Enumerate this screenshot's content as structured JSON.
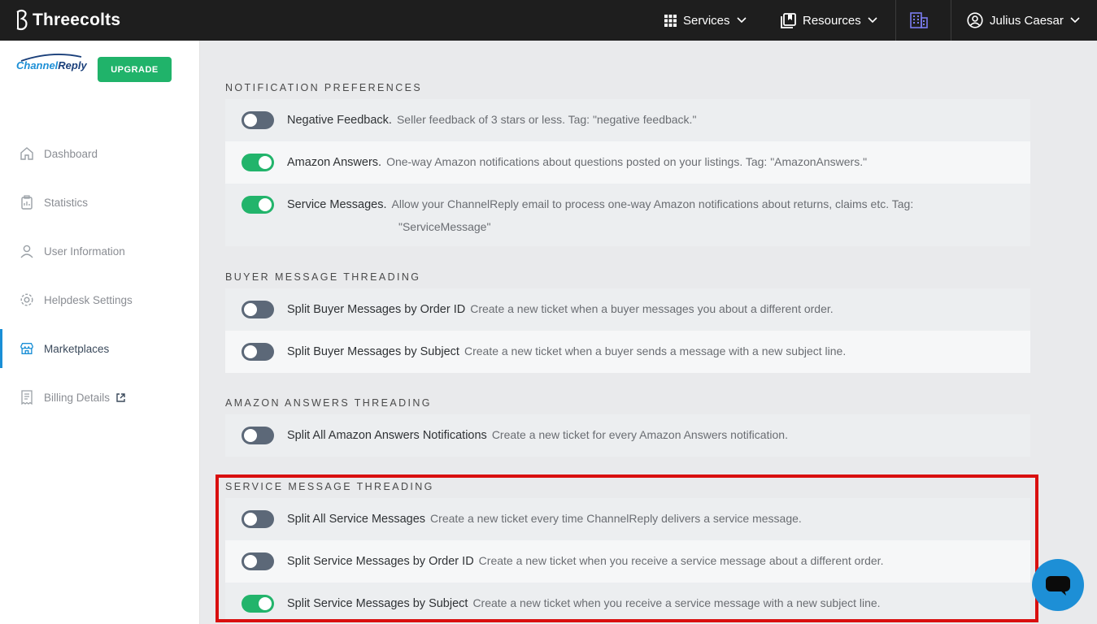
{
  "topbar": {
    "brand": "Threecolts",
    "services_label": "Services",
    "resources_label": "Resources",
    "user_name": "Julius Caesar"
  },
  "sidebar": {
    "logo_part1": "Channel",
    "logo_part2": "Reply",
    "upgrade_label": "UPGRADE",
    "items": [
      {
        "label": "Dashboard",
        "icon": "home-icon"
      },
      {
        "label": "Statistics",
        "icon": "clipboard-icon"
      },
      {
        "label": "User Information",
        "icon": "user-icon"
      },
      {
        "label": "Helpdesk Settings",
        "icon": "gear-icon"
      },
      {
        "label": "Marketplaces",
        "icon": "store-icon",
        "active": true
      },
      {
        "label": "Billing Details",
        "icon": "receipt-icon"
      }
    ]
  },
  "sections": [
    {
      "title": "NOTIFICATION PREFERENCES",
      "rows": [
        {
          "label": "Negative Feedback.",
          "desc": "Seller feedback of 3 stars or less. Tag: \"negative feedback.\"",
          "enabled": false
        },
        {
          "label": "Amazon Answers.",
          "desc": "One-way Amazon notifications about questions posted on your listings. Tag: \"AmazonAnswers.\"",
          "enabled": true
        },
        {
          "label": "Service Messages.",
          "desc": "Allow your ChannelReply email to process one-way Amazon notifications about returns, claims etc. Tag:",
          "desc2": "\"ServiceMessage\"",
          "enabled": true
        }
      ]
    },
    {
      "title": "BUYER MESSAGE THREADING",
      "rows": [
        {
          "label": "Split Buyer Messages by Order ID",
          "desc": "Create a new ticket when a buyer messages you about a different order.",
          "enabled": false
        },
        {
          "label": "Split Buyer Messages by Subject",
          "desc": "Create a new ticket when a buyer sends a message with a new subject line.",
          "enabled": false
        }
      ]
    },
    {
      "title": "AMAZON ANSWERS THREADING",
      "rows": [
        {
          "label": "Split All Amazon Answers Notifications",
          "desc": "Create a new ticket for every Amazon Answers notification.",
          "enabled": false
        }
      ]
    },
    {
      "title": "SERVICE MESSAGE THREADING",
      "rows": [
        {
          "label": "Split All Service Messages",
          "desc": "Create a new ticket every time ChannelReply delivers a service message.",
          "enabled": false
        },
        {
          "label": "Split Service Messages by Order ID",
          "desc": "Create a new ticket when you receive a service message about a different order.",
          "enabled": false
        },
        {
          "label": "Split Service Messages by Subject",
          "desc": "Create a new ticket when you receive a service message with a new subject line.",
          "enabled": true
        }
      ]
    }
  ],
  "colors": {
    "accent": "#1a8fd6",
    "toggle_on": "#22b46b",
    "toggle_off": "#5c6878",
    "highlight": "#d90f0f"
  }
}
